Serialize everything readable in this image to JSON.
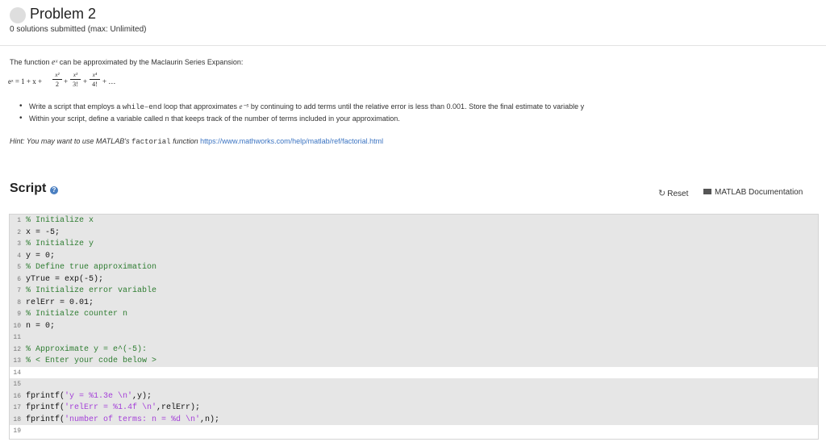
{
  "header": {
    "title": "Problem 2",
    "subtitle": "0 solutions submitted (max: Unlimited)"
  },
  "description": {
    "intro_before": "The function ",
    "intro_symbol": "eˣ",
    "intro_after": " can be approximated by the Maclaurin Series Expansion:",
    "equation": {
      "lhs": "eˣ = 1 + x +",
      "terms": [
        {
          "num": "x²",
          "den": "2",
          "sep": "+"
        },
        {
          "num": "x³",
          "den": "3!",
          "sep": "+"
        },
        {
          "num": "x⁴",
          "den": "4!",
          "sep": "+ …"
        }
      ]
    },
    "bullets": [
      {
        "before": "Write a script that employs a ",
        "code": "while–end",
        "middle": " loop that approximates ",
        "symbol": "e⁻⁵",
        "after": " by continuing to add terms until the relative error is less than 0.001. Store the final estimate to variable y"
      },
      {
        "text": "Within your script, define a variable called n that keeps track of the number of terms included in your approximation."
      }
    ],
    "hint": {
      "prefix": "Hint: You may want to use MATLAB's ",
      "code": "factorial",
      "suffix": " function ",
      "link": "https://www.mathworks.com/help/matlab/ref/factorial.html"
    }
  },
  "script": {
    "title": "Script",
    "reset_label": "Reset",
    "docs_label": "MATLAB Documentation",
    "lines": [
      {
        "n": "1",
        "text": "% Initialize x",
        "type": "comment",
        "shade": "gray"
      },
      {
        "n": "2",
        "text": "x = -5;",
        "type": "code",
        "shade": "gray"
      },
      {
        "n": "3",
        "text": "% Initialize y",
        "type": "comment",
        "shade": "gray"
      },
      {
        "n": "4",
        "text": "y = 0;",
        "type": "code",
        "shade": "gray"
      },
      {
        "n": "5",
        "text": "% Define true approximation",
        "type": "comment",
        "shade": "gray"
      },
      {
        "n": "6",
        "text": "yTrue = exp(-5);",
        "type": "code",
        "shade": "gray"
      },
      {
        "n": "7",
        "text": "% Initialize error variable",
        "type": "comment",
        "shade": "gray"
      },
      {
        "n": "8",
        "text": "relErr = 0.01;",
        "type": "code",
        "shade": "gray"
      },
      {
        "n": "9",
        "text": "% Initialze counter n",
        "type": "comment",
        "shade": "gray"
      },
      {
        "n": "10",
        "text": "n = 0;",
        "type": "code",
        "shade": "gray"
      },
      {
        "n": "11",
        "text": "",
        "type": "code",
        "shade": "gray"
      },
      {
        "n": "12",
        "text": "% Approximate y = e^(-5):",
        "type": "comment",
        "shade": "gray"
      },
      {
        "n": "13",
        "text": "% < Enter your code below >",
        "type": "comment",
        "shade": "gray"
      },
      {
        "n": "14",
        "text": "",
        "type": "code",
        "shade": "white"
      },
      {
        "n": "15",
        "text": "",
        "type": "code",
        "shade": "gray"
      },
      {
        "n": "16",
        "parts": [
          [
            "fprintf(",
            ""
          ],
          [
            "'y = %1.3e \\n'",
            "str"
          ],
          [
            ",y);",
            ""
          ]
        ],
        "shade": "gray"
      },
      {
        "n": "17",
        "parts": [
          [
            "fprintf(",
            ""
          ],
          [
            "'relErr = %1.4f \\n'",
            "str"
          ],
          [
            ",relErr);",
            ""
          ]
        ],
        "shade": "gray"
      },
      {
        "n": "18",
        "parts": [
          [
            "fprintf(",
            ""
          ],
          [
            "'number of terms: n = %d \\n'",
            "str"
          ],
          [
            ",n);",
            ""
          ]
        ],
        "shade": "gray"
      },
      {
        "n": "19",
        "text": "",
        "type": "code",
        "shade": "white"
      }
    ]
  }
}
